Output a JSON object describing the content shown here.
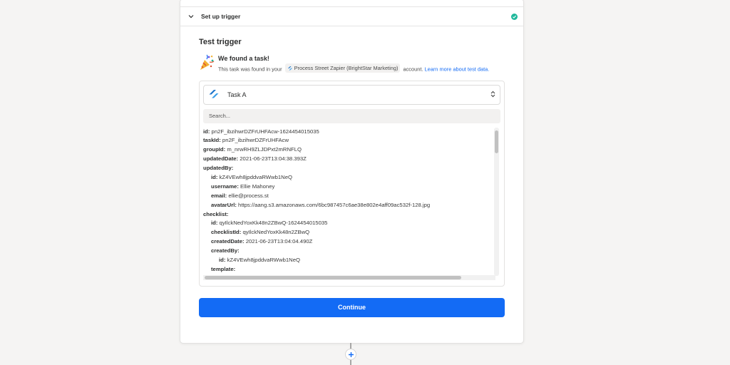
{
  "step": {
    "title": "Set up trigger",
    "status_color": "#1fb89b"
  },
  "test": {
    "section_title": "Test trigger",
    "found_title": "We found a task!",
    "found_prefix": "This task was found in your",
    "account_name": "Process Street Zapier (BrightStar Marketing)",
    "found_suffix": "account.",
    "learn_more": "Learn more about test data."
  },
  "task_select": {
    "value": "Task A",
    "icon": "process-street-icon"
  },
  "search": {
    "placeholder": "Search..."
  },
  "tree": [
    {
      "key": "id:",
      "value": "pn2F_ibzihwrDZFrUHFAcw-1624454015035"
    },
    {
      "key": "taskId:",
      "value": "pn2F_ibzihwrDZFrUHFAcw"
    },
    {
      "key": "groupId:",
      "value": "m_nrwRH9ZLJDPxt2mRNFLQ"
    },
    {
      "key": "updatedDate:",
      "value": "2021-06-23T13:04:38.393Z"
    },
    {
      "key": "updatedBy:",
      "value": ""
    },
    {
      "key": "id:",
      "value": "kZ4VEwh8jpddvaRWwb1NeQ"
    },
    {
      "key": "username:",
      "value": "Ellie Mahoney"
    },
    {
      "key": "email:",
      "value": "ellie@process.st"
    },
    {
      "key": "avatarUrl:",
      "value": "https://aang.s3.amazonaws.com/6bc987457c6ae38e802e4aff09ac532f-128.jpg"
    },
    {
      "key": "checklist:",
      "value": ""
    },
    {
      "key": "id:",
      "value": "qyIlckNedYoxKk48n2ZBwQ-1624454015035"
    },
    {
      "key": "checklistId:",
      "value": "qyIlckNedYoxKk48n2ZBwQ"
    },
    {
      "key": "createdDate:",
      "value": "2021-06-23T13:04:04.490Z"
    },
    {
      "key": "createdBy:",
      "value": ""
    },
    {
      "key": "id:",
      "value": "kZ4VEwh8jpddvaRWwb1NeQ"
    },
    {
      "key": "template:",
      "value": ""
    }
  ],
  "continue_label": "Continue",
  "colors": {
    "primary": "#136bf5",
    "success": "#1fb89b"
  }
}
